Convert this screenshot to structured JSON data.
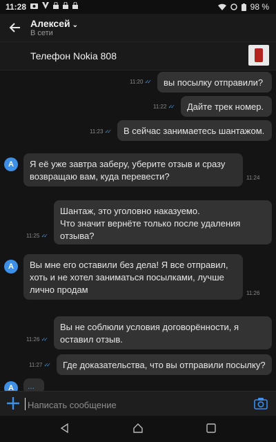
{
  "status_bar": {
    "time": "11:28",
    "battery": "98 %"
  },
  "header": {
    "contact_name": "Алексей",
    "contact_status": "В сети"
  },
  "topic": {
    "title": "Телефон Nokia 808"
  },
  "messages": [
    {
      "direction": "out",
      "text": "вы посылку отправили?",
      "time": "11:20"
    },
    {
      "direction": "out",
      "text": "Дайте трек номер.",
      "time": "11:22"
    },
    {
      "direction": "out",
      "text": "В сейчас занимаетесь шантажом.",
      "time": "11:23"
    },
    {
      "direction": "in",
      "avatar": "A",
      "lines": [
        "Я её уже завтра заберу, уберите отзыв и сразу",
        "возвращаю вам, куда перевести?"
      ],
      "time": "11:24"
    },
    {
      "direction": "out",
      "lines": [
        "Шантаж, это уголовно наказуемо.",
        "Что значит вернёте только после удаления",
        "отзыва?"
      ],
      "time": "11:25"
    },
    {
      "direction": "in",
      "avatar": "A",
      "lines": [
        "Вы мне его оставили без дела! Я все отправил,",
        "хоть и не хотел заниматься посылками, лучше",
        "лично продам"
      ],
      "time": "11:26"
    },
    {
      "direction": "out",
      "lines": [
        "Вы не соблюли условия договорённости, я",
        "оставил отзыв."
      ],
      "time": "11:26"
    },
    {
      "direction": "out",
      "text": "Где доказательства, что вы отправили посылку?",
      "time": "11:27"
    },
    {
      "direction": "in",
      "avatar": "A",
      "typing": "..."
    }
  ],
  "composer": {
    "placeholder": "Написать сообщение"
  },
  "colors": {
    "accent": "#3d8fe8",
    "background": "#141414",
    "bubble": "#333333"
  }
}
